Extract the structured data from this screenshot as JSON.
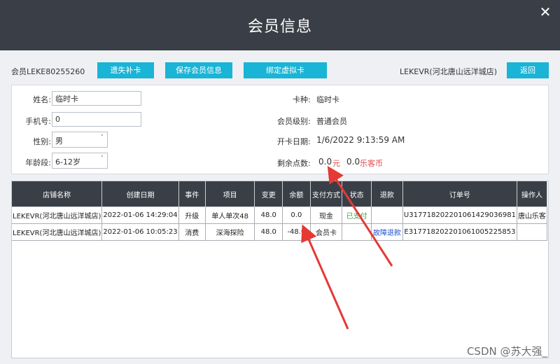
{
  "window": {
    "title": "会员信息"
  },
  "toolbar": {
    "member_id": "会员LEKE80255260",
    "btn_lost": "遗失补卡",
    "btn_save": "保存会员信息",
    "btn_bind": "绑定虚拟卡",
    "store": "LEKEVR(河北唐山远洋城店)",
    "btn_back": "返回"
  },
  "form": {
    "name_label": "姓名:",
    "name_value": "临时卡",
    "phone_label": "手机号:",
    "phone_value": "0",
    "gender_label": "性别:",
    "gender_value": "男",
    "age_label": "年龄段:",
    "age_value": "6-12岁",
    "card_type_label": "卡种:",
    "card_type_value": "临时卡",
    "level_label": "会员级别:",
    "level_value": "普通会员",
    "open_label": "开卡日期:",
    "open_value": "1/6/2022 9:13:59 AM",
    "points_label": "剩余点数:",
    "points_value": "0.0",
    "points_unit": "元",
    "coins_value": "0.0",
    "coins_unit": "乐客币"
  },
  "table": {
    "headers": [
      "店铺名称",
      "创建日期",
      "事件",
      "项目",
      "变更",
      "余额",
      "支付方式",
      "状态",
      "退款",
      "订单号",
      "操作人"
    ],
    "rows": [
      [
        "LEKEVR(河北唐山远洋城店)",
        "2022-01-06 14:29:04",
        "升级",
        "单人单次48",
        "48.0",
        "0.0",
        "现金",
        "已支付",
        "",
        "U317718202201061429036981",
        "唐山乐客"
      ],
      [
        "LEKEVR(河北唐山远洋城店)",
        "2022-01-06 10:05:23",
        "消费",
        "深海探险",
        "48.0",
        "-48.0",
        "会员卡",
        "",
        "故障退款",
        "E317718202201061005225853",
        ""
      ]
    ]
  },
  "watermark": "CSDN @苏大强_",
  "colors": {
    "titlebar": "#3a3f47",
    "accent": "#19b4d6",
    "annotation": "#e53935"
  }
}
